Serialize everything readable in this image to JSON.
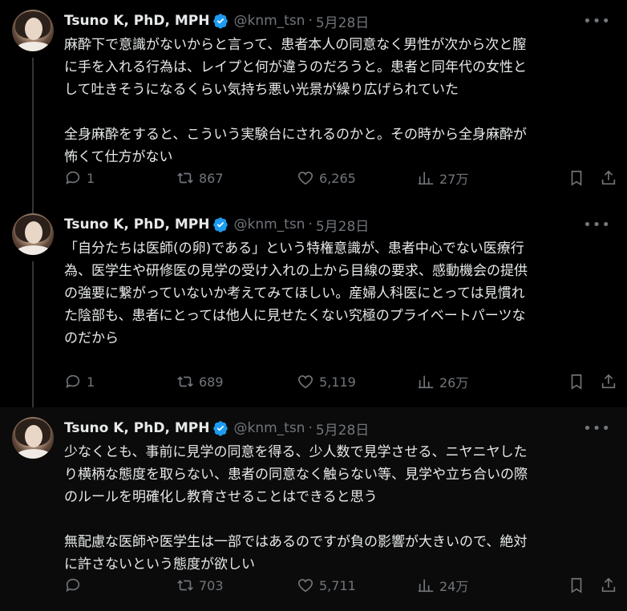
{
  "tweets": [
    {
      "name": "Tsuno K, PhD, MPH",
      "handle": "@knm_tsn",
      "separator": "·",
      "date": "5月28日",
      "text": "麻酔下で意識がないからと言って、患者本人の同意なく男性が次から次と膣\nに手を入れる行為は、レイプと何が違うのだろうと。患者と同年代の女性と\nして吐きそうになるくらい気持ち悪い光景が繰り広げられていた\n\n全身麻酔をすると、こういう実験台にされるのかと。その時から全身麻酔が\n怖くて仕方がない",
      "replies": "1",
      "retweets": "867",
      "likes": "6,265",
      "views": "27万"
    },
    {
      "name": "Tsuno K, PhD, MPH",
      "handle": "@knm_tsn",
      "separator": "·",
      "date": "5月28日",
      "text": "「自分たちは医師(の卵)である」という特権意識が、患者中心でない医療行\n為、医学生や研修医の見学の受け入れの上から目線の要求、感動機会の提供\nの強要に繋がっていないか考えてみてほしい。産婦人科医にとっては見慣れ\nた陰部も、患者にとっては他人に見せたくない究極のプライベートパーツな\nのだから",
      "replies": "1",
      "retweets": "689",
      "likes": "5,119",
      "views": "26万"
    },
    {
      "name": "Tsuno K, PhD, MPH",
      "handle": "@knm_tsn",
      "separator": "·",
      "date": "5月28日",
      "text": "少なくとも、事前に見学の同意を得る、少人数で見学させる、ニヤニヤした\nり横柄な態度を取らない、患者の同意なく触らない等、見学や立ち合いの際\nのルールを明確化し教育させることはできると思う\n\n無配慮な医師や医学生は一部ではあるのですが負の影響が大きいので、絶対\nに許さないという態度が欲しい",
      "replies": "",
      "retweets": "703",
      "likes": "5,711",
      "views": "24万"
    }
  ],
  "colors": {
    "verified": "#1d9bf0",
    "muted": "#71767b",
    "text": "#e7e9ea"
  },
  "icons": [
    "reply-icon",
    "retweet-icon",
    "like-icon",
    "views-icon",
    "bookmark-icon",
    "share-icon",
    "more-icon",
    "verified-icon"
  ]
}
